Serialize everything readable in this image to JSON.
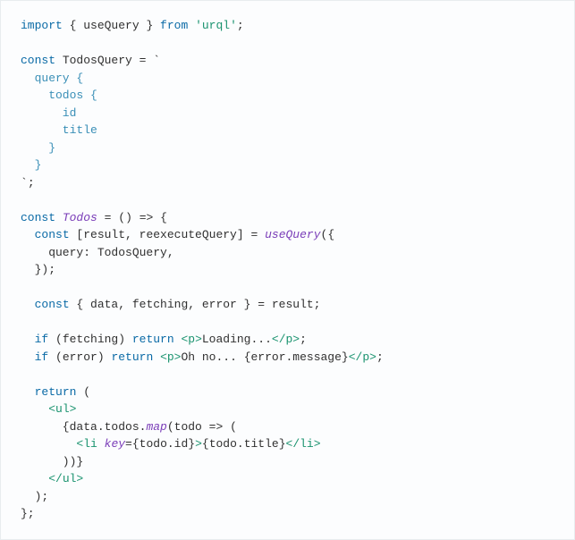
{
  "code": {
    "l01_a": "import",
    "l01_b": " { ",
    "l01_c": "useQuery",
    "l01_d": " } ",
    "l01_e": "from",
    "l01_f": " ",
    "l01_g": "'urql'",
    "l01_h": ";",
    "l02": "",
    "l03_a": "const",
    "l03_b": " TodosQuery ",
    "l03_c": "=",
    "l03_d": " `",
    "l04": "  query {",
    "l05": "    todos {",
    "l06": "      id",
    "l07": "      title",
    "l08": "    }",
    "l09": "  }",
    "l10_a": "`",
    "l10_b": ";",
    "l11": "",
    "l12_a": "const",
    "l12_b": " ",
    "l12_c": "Todos",
    "l12_d": " ",
    "l12_e": "=",
    "l12_f": " () ",
    "l12_g": "=>",
    "l12_h": " {",
    "l13_a": "  ",
    "l13_b": "const",
    "l13_c": " [result, reexecuteQuery] ",
    "l13_d": "=",
    "l13_e": " ",
    "l13_f": "useQuery",
    "l13_g": "({",
    "l14": "    query: TodosQuery,",
    "l15": "  });",
    "l16": "",
    "l17_a": "  ",
    "l17_b": "const",
    "l17_c": " { data, fetching, error } ",
    "l17_d": "=",
    "l17_e": " result;",
    "l18": "",
    "l19_a": "  ",
    "l19_b": "if",
    "l19_c": " (fetching) ",
    "l19_d": "return",
    "l19_e": " ",
    "l19_f": "<p>",
    "l19_g": "Loading...",
    "l19_h": "</p>",
    "l19_i": ";",
    "l20_a": "  ",
    "l20_b": "if",
    "l20_c": " (error) ",
    "l20_d": "return",
    "l20_e": " ",
    "l20_f": "<p>",
    "l20_g": "Oh no... ",
    "l20_h": "{error.message}",
    "l20_i": "</p>",
    "l20_j": ";",
    "l21": "",
    "l22_a": "  ",
    "l22_b": "return",
    "l22_c": " (",
    "l23_a": "    ",
    "l23_b": "<ul>",
    "l24_a": "      {data.todos.",
    "l24_b": "map",
    "l24_c": "(todo ",
    "l24_d": "=>",
    "l24_e": " (",
    "l25_a": "        ",
    "l25_b": "<li",
    "l25_c": " ",
    "l25_d": "key",
    "l25_e": "=",
    "l25_f": "{todo.id}",
    "l25_g": ">",
    "l25_h": "{todo.title}",
    "l25_i": "</li>",
    "l26": "      ))}",
    "l27_a": "    ",
    "l27_b": "</ul>",
    "l28": "  );",
    "l29": "};"
  }
}
